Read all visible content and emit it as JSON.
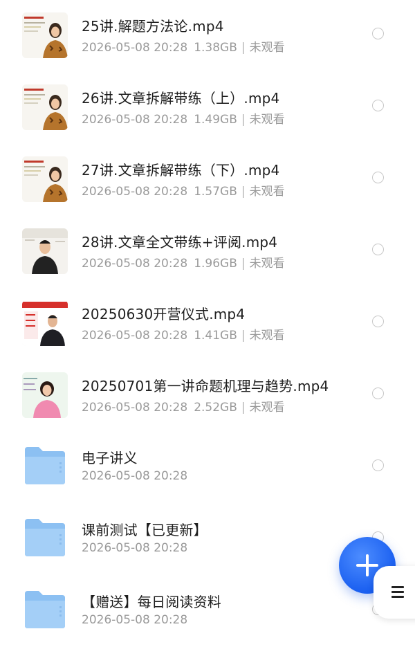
{
  "items": [
    {
      "kind": "video",
      "name": "25讲.解题方法论.mp4",
      "date": "2026-05-08 20:28",
      "size": "1.38GB",
      "status": "未观看",
      "thumb": "lecture-woman"
    },
    {
      "kind": "video",
      "name": "26讲.文章拆解带练（上）.mp4",
      "date": "2026-05-08 20:28",
      "size": "1.49GB",
      "status": "未观看",
      "thumb": "lecture-woman"
    },
    {
      "kind": "video",
      "name": "27讲.文章拆解带练（下）.mp4",
      "date": "2026-05-08 20:28",
      "size": "1.57GB",
      "status": "未观看",
      "thumb": "lecture-woman"
    },
    {
      "kind": "video",
      "name": "28讲.文章全文带练+评阅.mp4",
      "date": "2026-05-08 20:28",
      "size": "1.96GB",
      "status": "未观看",
      "thumb": "lecture-man"
    },
    {
      "kind": "video",
      "name": "20250630开营仪式.mp4",
      "date": "2026-05-08 20:28",
      "size": "1.41GB",
      "status": "未观看",
      "thumb": "lecture-man-red"
    },
    {
      "kind": "video",
      "name": "20250701第一讲命题机理与趋势.mp4",
      "date": "2026-05-08 20:28",
      "size": "2.52GB",
      "status": "未观看",
      "thumb": "lecture-woman-pink"
    },
    {
      "kind": "folder",
      "name": "电子讲义",
      "date": "2026-05-08 20:28"
    },
    {
      "kind": "folder",
      "name": "课前测试【已更新】",
      "date": "2026-05-08 20:28"
    },
    {
      "kind": "folder",
      "name": "【赠送】每日阅读资料",
      "date": "2026-05-08 20:28"
    }
  ],
  "meta_separator": "|",
  "icons": {
    "folder": "folder-icon",
    "video": "video-thumbnail",
    "fab": "plus-icon",
    "menu": "menu-icon",
    "select": "radio-circle-icon"
  },
  "colors": {
    "folder": "#8cc0f2",
    "fab": "#2566f2",
    "meta": "#9a9a9a"
  }
}
